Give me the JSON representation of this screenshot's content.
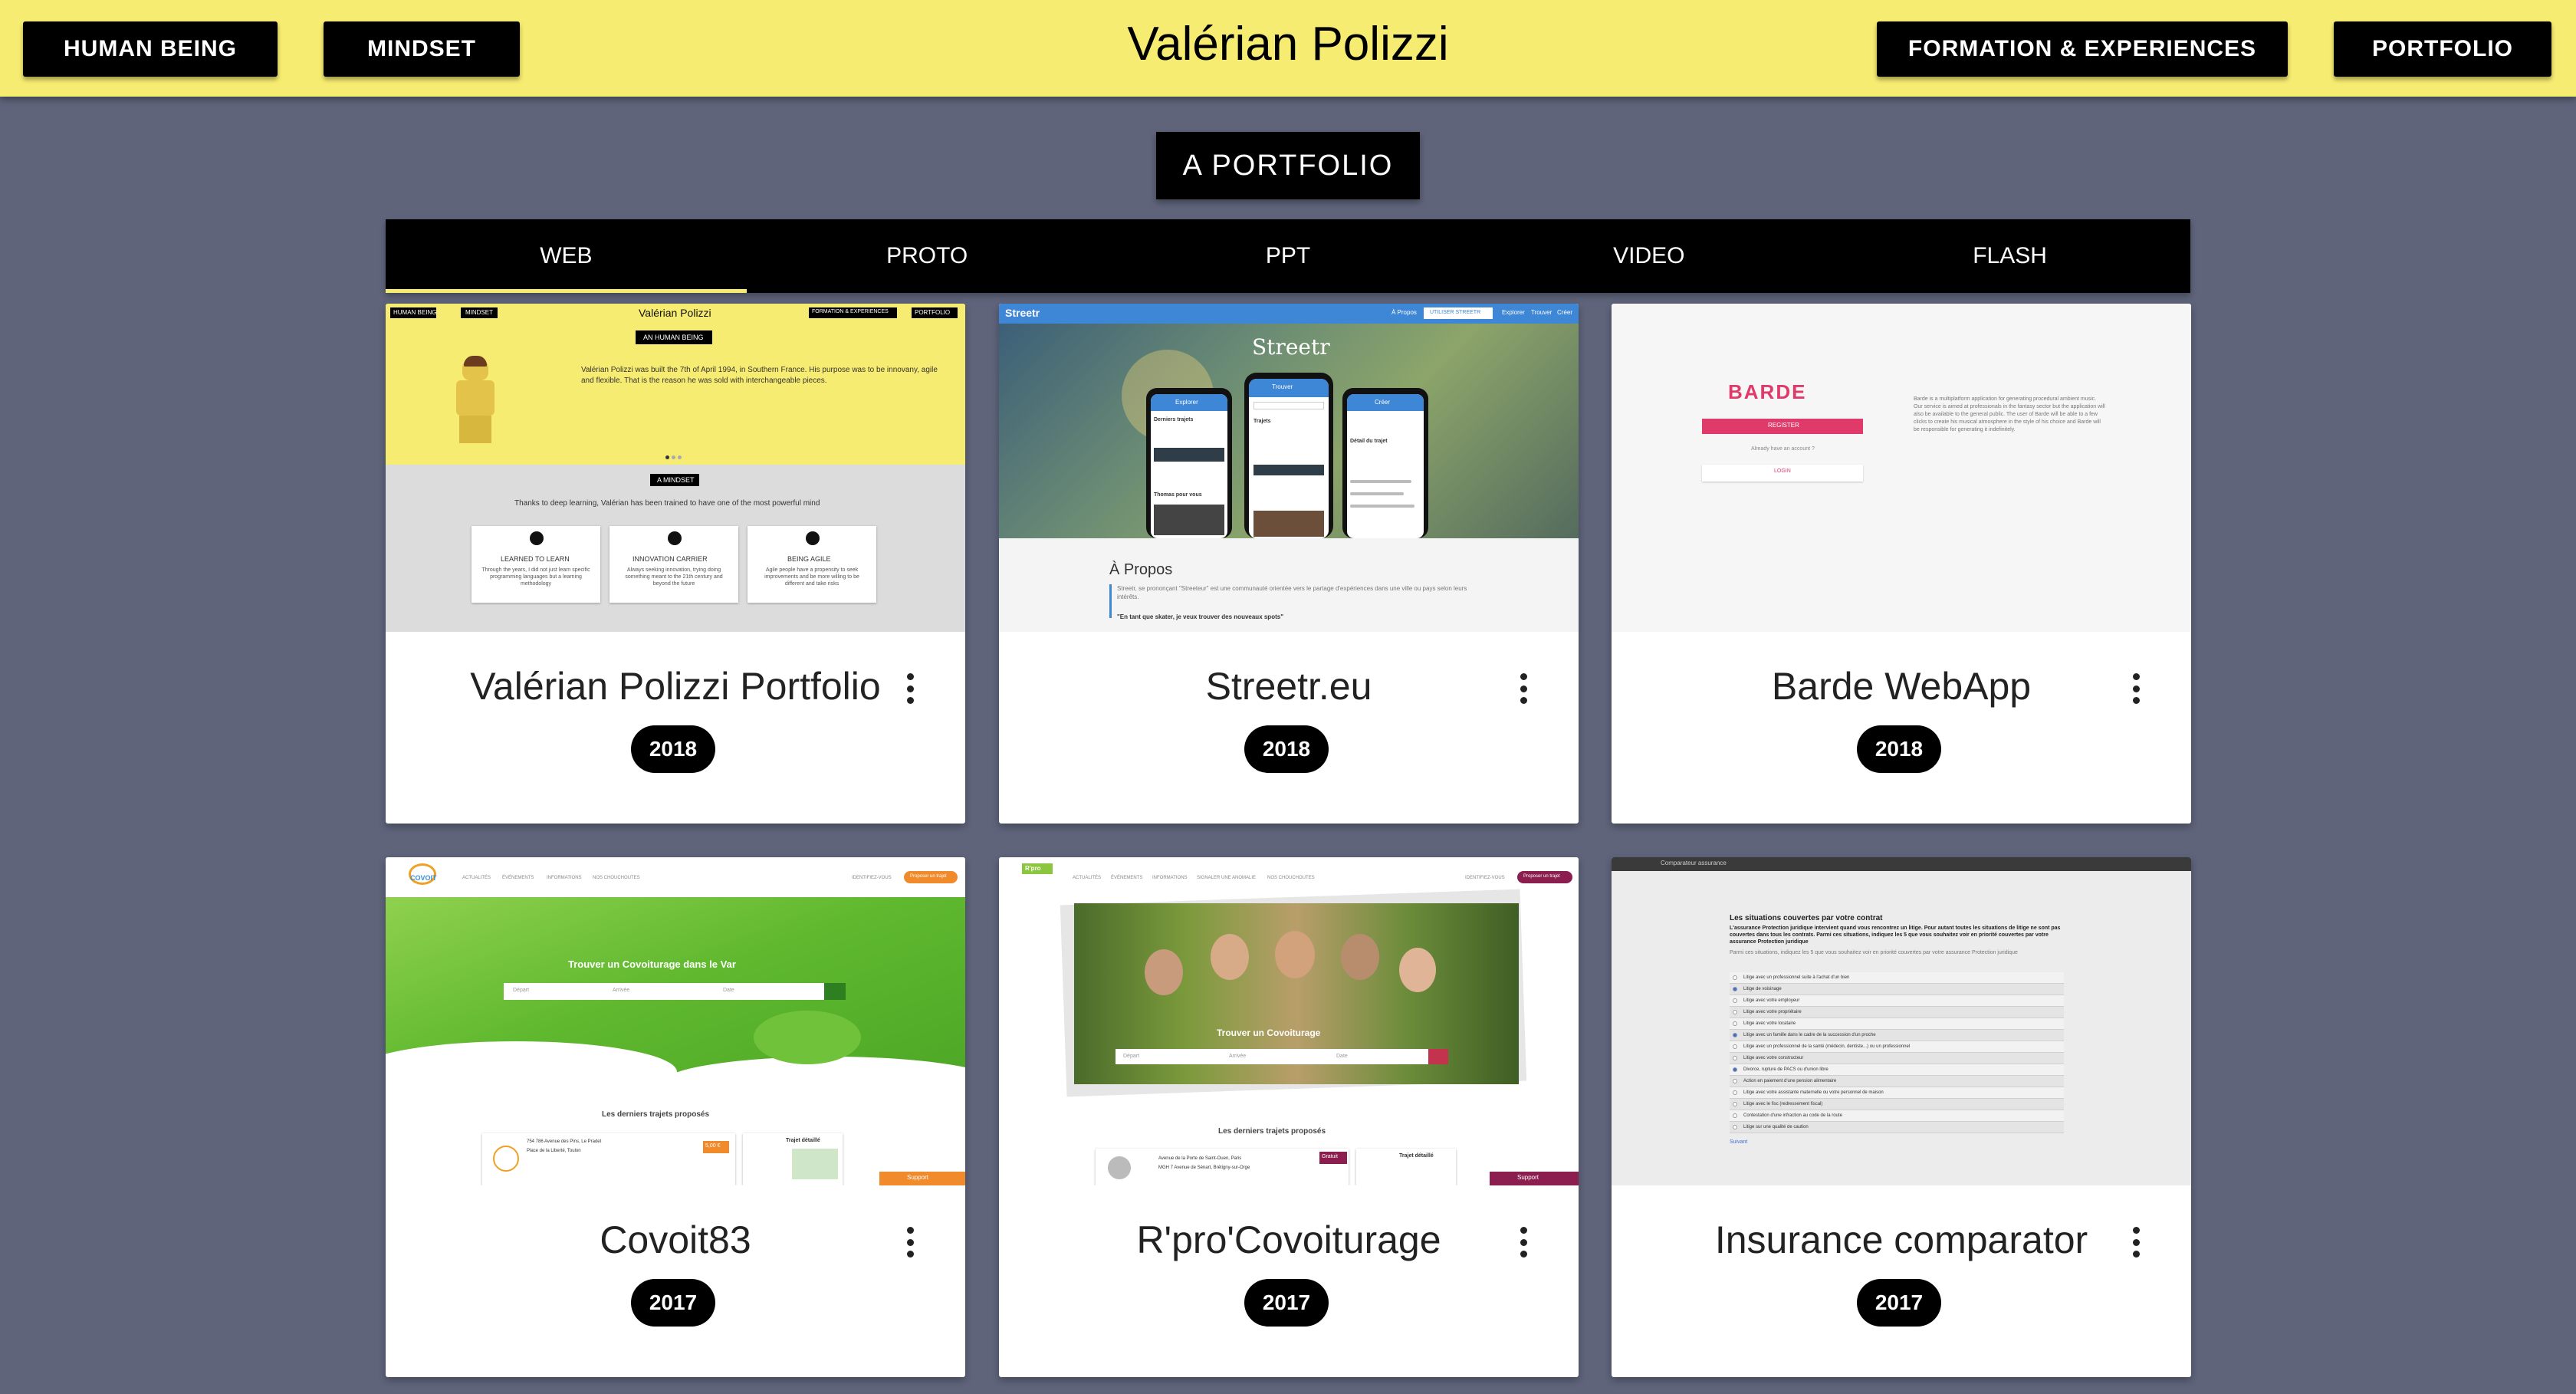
{
  "header": {
    "title": "Valérian Polizzi",
    "nav": {
      "human_being": "HUMAN BEING",
      "mindset": "MINDSET",
      "formation": "FORMATION & EXPERIENCES",
      "portfolio": "PORTFOLIO"
    }
  },
  "section": {
    "title": "A PORTFOLIO"
  },
  "tabs": [
    "WEB",
    "PROTO",
    "PPT",
    "VIDEO",
    "FLASH"
  ],
  "active_tab": "WEB",
  "colors": {
    "header_bg": "#f7ec72",
    "page_bg": "#5f647b",
    "accent": "#000000"
  },
  "cards": [
    {
      "title": "Valérian Polizzi Portfolio",
      "year": "2018",
      "thumb": {
        "nav": [
          "HUMAN BEING",
          "MINDSET",
          "FORMATION & EXPERIENCES",
          "PORTFOLIO"
        ],
        "title": "Valérian Polizzi",
        "button": "AN HUMAN BEING",
        "intro": "Valérian Polizzi was built the 7th of April 1994, in Southern France. His purpose was to be innovany, agile and flexible. That is the reason he was sold with interchangeable pieces.",
        "mindset_button": "A MINDSET",
        "mindset_text": "Thanks to deep learning, Valérian has been trained to have one of the most powerful mind",
        "skills": [
          {
            "title": "LEARNED TO LEARN",
            "text": "Through the years, I did not just learn specific programming languages but a learning methodology"
          },
          {
            "title": "INNOVATION CARRIER",
            "text": "Always seeking innovation, trying doing something meant to the 21th century and beyond the future"
          },
          {
            "title": "BEING AGILE",
            "text": "Agile people have a propensity to seek improvements and be more willing to be different and take risks"
          }
        ]
      }
    },
    {
      "title": "Streetr.eu",
      "year": "2018",
      "thumb": {
        "brand": "Streetr",
        "nav": [
          "À Propos",
          "UTILISER STREETR",
          "Explorer",
          "Trouver",
          "Créer"
        ],
        "hero": "Streetr",
        "phones": [
          "Explorer",
          "Trouver",
          "Créer"
        ],
        "phone_sections": [
          "Derniers trajets",
          "Trajets",
          "Thomas pour vous",
          "Détail du trajet"
        ],
        "about_title": "À Propos",
        "about_text": "Streetr, se prononçant \"Streeteur\" est une communauté orientée vers le partage d'expériences dans une ville ou pays selon leurs intérêts.",
        "quote": "\"En tant que skater, je veux trouver des nouveaux spots\""
      }
    },
    {
      "title": "Barde WebApp",
      "year": "2018",
      "thumb": {
        "logo": "BARDE",
        "register": "REGISTER",
        "account": "Already have an account ?",
        "login": "LOGIN",
        "description": "Barde is a multiplatform application for generating procedural ambient music. Our service is aimed at professionals in the fantasy sector but the application will also be available to the general public. The user of Barde will be able to a few clicks to create his musical atmosphere in the style of his choice and Barde will be responsible for generating it indefinitely."
      }
    },
    {
      "title": "Covoit83",
      "year": "2017",
      "thumb": {
        "logo": "COVOIT",
        "nav": [
          "ACTUALITÉS",
          "ÉVÉNEMENTS",
          "INFORMATIONS",
          "NOS CHOUCHOUTES"
        ],
        "login": "IDENTIFIEZ-VOUS",
        "cta": "Proposer un trajet",
        "hero": "Trouver un Covoiturage dans le Var",
        "fields": [
          "Départ",
          "Arrivée",
          "Date"
        ],
        "latest": "Les derniers trajets proposés",
        "trip_from": "754 786 Avenue des Pins, Le Pradet",
        "trip_to": "Place de la Liberté, Toulon",
        "price": "5,00 €",
        "detail": "Trajet détaillé",
        "support": "Support"
      }
    },
    {
      "title": "R'pro'Covoiturage",
      "year": "2017",
      "thumb": {
        "logo": "R'pro",
        "nav": [
          "ACTUALITÉS",
          "ÉVÉNEMENTS",
          "INFORMATIONS",
          "SIGNALER UNE ANOMALIE",
          "NOS CHOUCHOUTES"
        ],
        "login": "IDENTIFIEZ-VOUS",
        "cta": "Proposer un trajet",
        "hero": "Trouver un Covoiturage",
        "fields": [
          "Départ",
          "Arrivée",
          "Date"
        ],
        "latest": "Les derniers trajets proposés",
        "trip_from": "Avenue de la Porte de Saint-Ouen, Paris",
        "trip_to": "MGH 7 Avenue de Sénart, Brétigny-sur-Orge",
        "price": "Gratuit",
        "detail": "Trajet détaillé",
        "support": "Support"
      }
    },
    {
      "title": "Insurance comparator",
      "year": "2017",
      "thumb": {
        "window_title": "Comparateur assurance",
        "heading": "Les situations couvertes par votre contrat",
        "intro": "L'assurance Protection juridique intervient quand vous rencontrez un litige. Pour autant toutes les situations de litige ne sont pas couvertes dans tous les contrats. Parmi ces situations, indiquez les 5 que vous souhaitez voir en priorité couvertes par votre assurance Protection juridique",
        "sub": "Parmi ces situations, indiquez les 5 que vous souhaitez voir en priorité couvertes par votre assurance Protection juridique",
        "items": [
          "Litige avec un professionnel suite à l'achat d'un bien",
          "Litige de voisinage",
          "Litige avec votre employeur",
          "Litige avec votre propriétaire",
          "Litige avec votre locataire",
          "Litige avec un famille dans le cadre de la succession d'un proche",
          "Litige avec un professionnel de la santé (médecin, dentiste...) ou un professionnel",
          "Litige avec votre constructeur",
          "Divorce, rupture de PACS ou d'union libre",
          "Action en paiement d'une pension alimentaire",
          "Litige avec votre assistante maternelle ou votre personnel de maison",
          "Litige avec le fisc (redressement fiscal)",
          "Contestation d'une infraction au code de la route",
          "Litige sur une qualité de caution"
        ],
        "next": "Suivant"
      }
    }
  ]
}
